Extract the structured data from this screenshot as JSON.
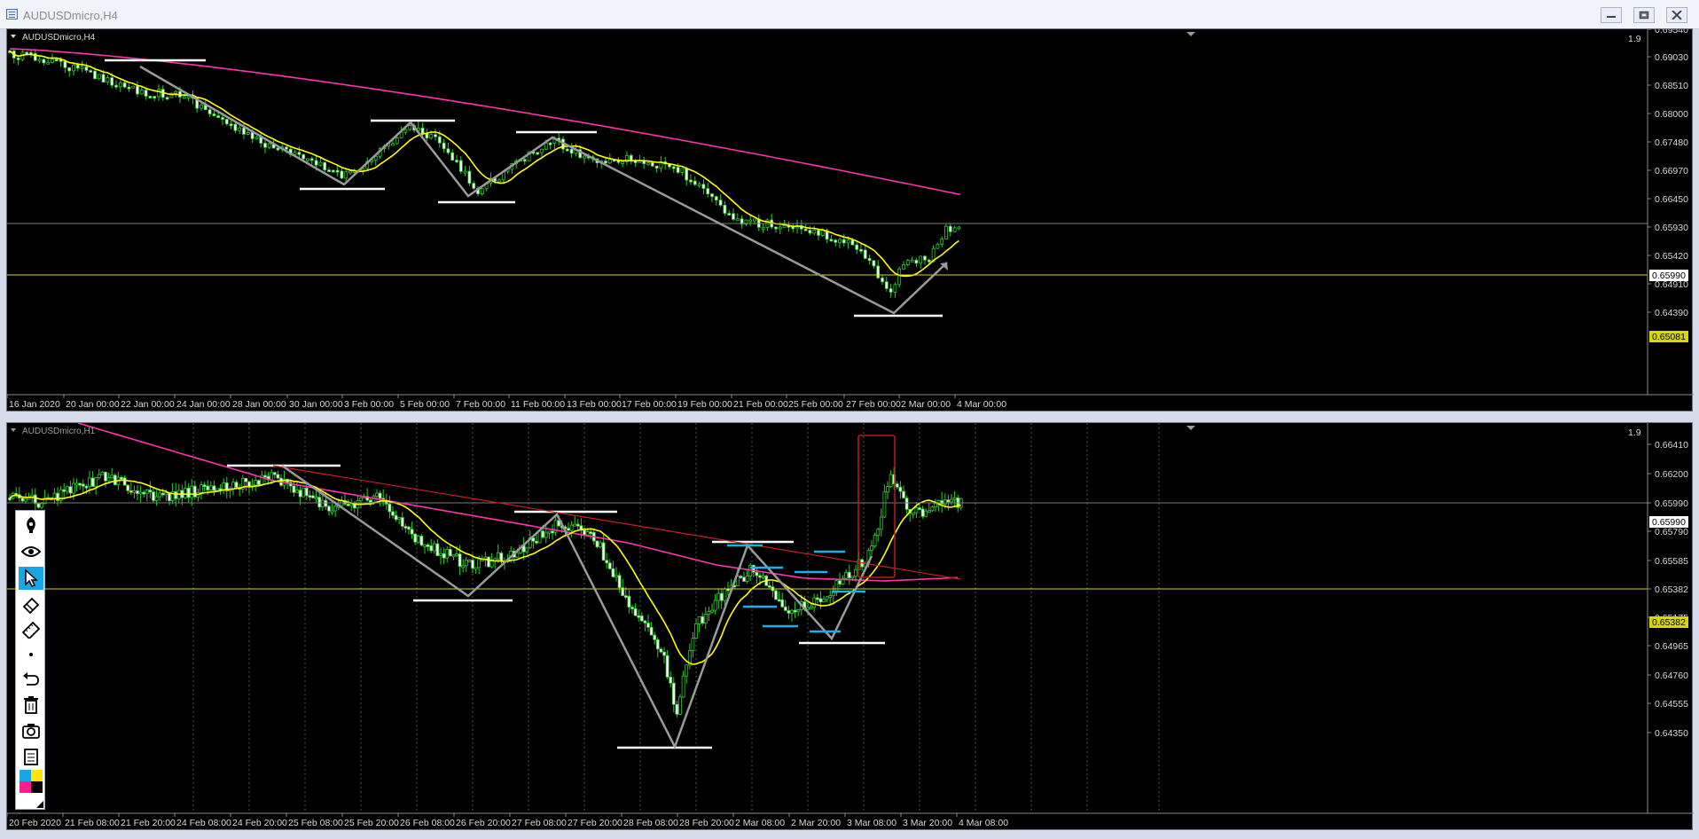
{
  "window": {
    "title": "AUDUSDmicro,H4"
  },
  "top_chart": {
    "symbol_label": "AUDUSDmicro,H4",
    "corner_value": "1.9",
    "price_ticks": [
      "0.69540",
      "0.69030",
      "0.68510",
      "0.68000",
      "0.67480",
      "0.66970",
      "0.66450",
      "0.65930",
      "0.65420",
      "0.64910",
      "0.64390"
    ],
    "current_price_label": "0.65990",
    "level_price_label": "0.65081",
    "time_ticks": [
      "16 Jan 2020",
      "20 Jan 00:00",
      "22 Jan 00:00",
      "24 Jan 00:00",
      "28 Jan 00:00",
      "30 Jan 00:00",
      "3 Feb 00:00",
      "5 Feb 00:00",
      "7 Feb 00:00",
      "11 Feb 00:00",
      "13 Feb 00:00",
      "17 Feb 00:00",
      "19 Feb 00:00",
      "21 Feb 00:00",
      "25 Feb 00:00",
      "27 Feb 00:00",
      "2 Mar 00:00",
      "4 Mar 00:00"
    ],
    "colors": {
      "bull": "#32c832",
      "bear": "#ffffff",
      "ma_fast": "#ffff00",
      "ma_slow": "#ff33aa",
      "level": "#d8d800",
      "drawing": "#9a9a9a"
    }
  },
  "bottom_chart": {
    "symbol_label": "AUDUSDmicro,H1",
    "corner_value": "1.9",
    "price_ticks": [
      "0.66410",
      "0.66200",
      "0.65990",
      "0.65790",
      "0.65585",
      "0.65382",
      "0.65175",
      "0.64965",
      "0.64760",
      "0.64555",
      "0.64350"
    ],
    "current_price_label": "0.65990",
    "level_price_label": "0.65382",
    "time_ticks": [
      "20 Feb 2020",
      "21 Feb 08:00",
      "21 Feb 20:00",
      "24 Feb 08:00",
      "24 Feb 20:00",
      "25 Feb 08:00",
      "25 Feb 20:00",
      "26 Feb 08:00",
      "26 Feb 20:00",
      "27 Feb 08:00",
      "27 Feb 20:00",
      "28 Feb 08:00",
      "28 Feb 20:00",
      "2 Mar 08:00",
      "2 Mar 20:00",
      "3 Mar 08:00",
      "3 Mar 20:00",
      "4 Mar 08:00"
    ],
    "colors": {
      "bull": "#32c832",
      "bear": "#ffffff",
      "ma_fast": "#ffff00",
      "ma_slow": "#ff33aa",
      "level": "#d8d800",
      "drawing": "#9a9a9a",
      "trend": "#c81e1e",
      "marker": "#1ab0e8",
      "box": "#b41e1e"
    }
  },
  "toolbar": {
    "tools": [
      "pen-icon",
      "eye-icon",
      "cursor-icon",
      "eraser-icon",
      "ruler-icon",
      "dot-icon",
      "undo-icon",
      "trash-icon",
      "camera-icon",
      "clipboard-icon",
      "color-palette-icon"
    ],
    "palette": [
      "#1aa6e6",
      "#ffe600",
      "#ff1e8c",
      "#000000"
    ]
  }
}
